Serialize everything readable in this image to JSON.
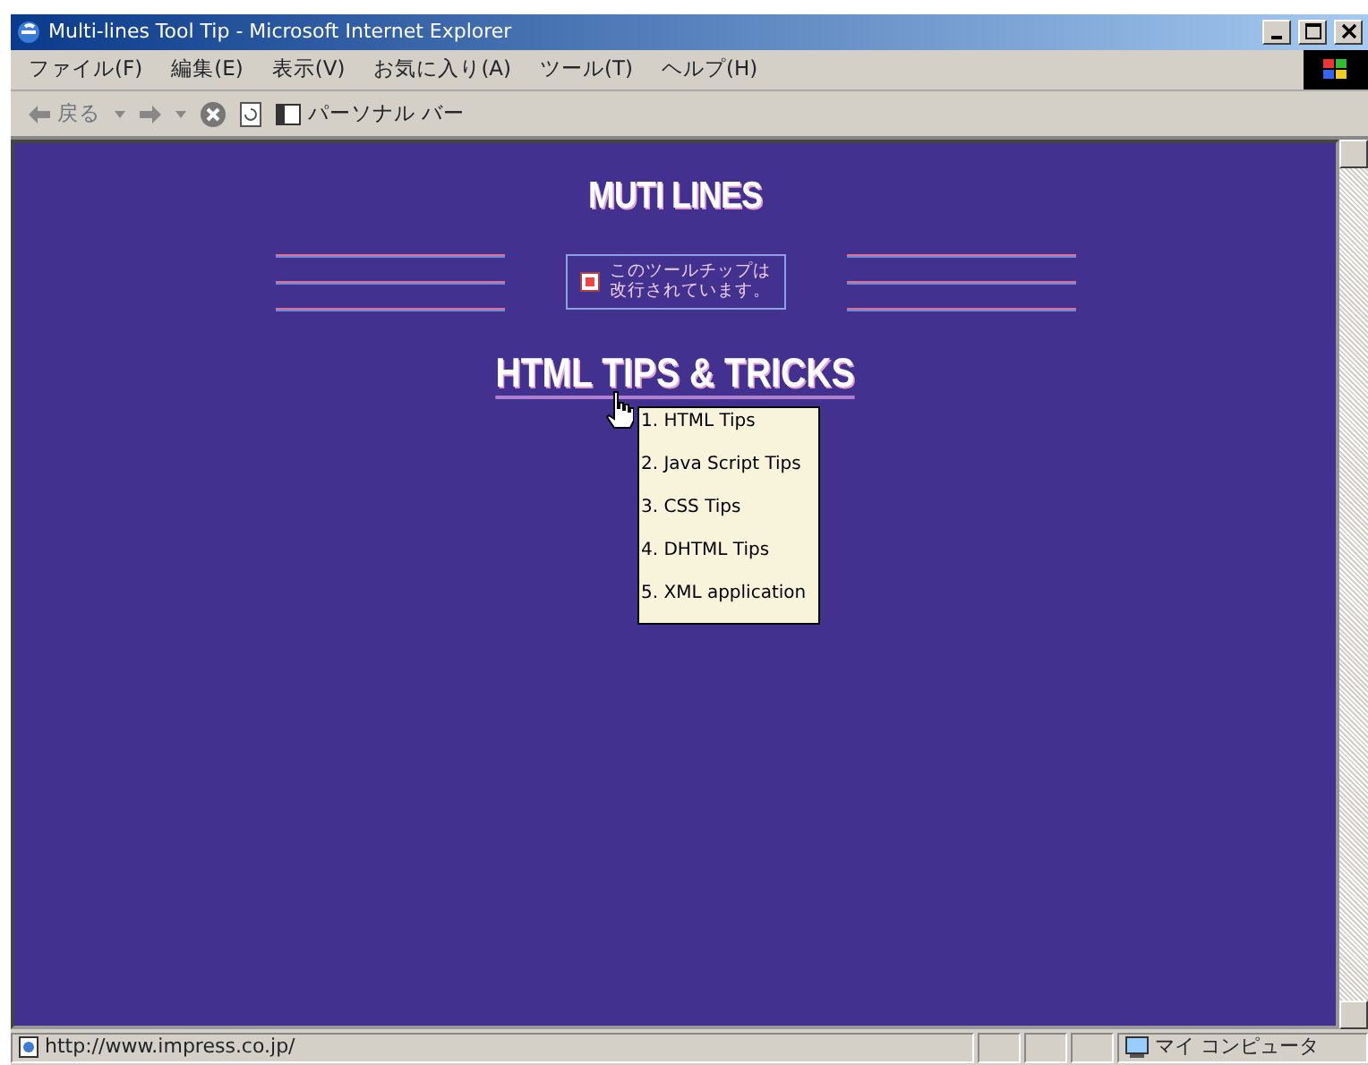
{
  "window": {
    "title": "Multi-lines Tool Tip - Microsoft Internet Explorer"
  },
  "menu": [
    "ファイル(F)",
    "編集(E)",
    "表示(V)",
    "お気に入り(A)",
    "ツール(T)",
    "ヘルプ(H)"
  ],
  "toolbar": {
    "back": "戻る",
    "personal_bar": "パーソナル バー"
  },
  "page": {
    "heading": "MUTI LINES",
    "tooltip_lines": [
      "このツールチップは",
      "改行されています。"
    ],
    "link": "HTML TIPS & TRICKS",
    "popup_items": [
      "1. HTML Tips",
      "2. Java Script Tips",
      "3. CSS Tips",
      "4. DHTML Tips",
      "5. XML application"
    ]
  },
  "status_bar": {
    "url": "http://www.impress.co.jp/",
    "zone": "マイ コンピュータ"
  }
}
